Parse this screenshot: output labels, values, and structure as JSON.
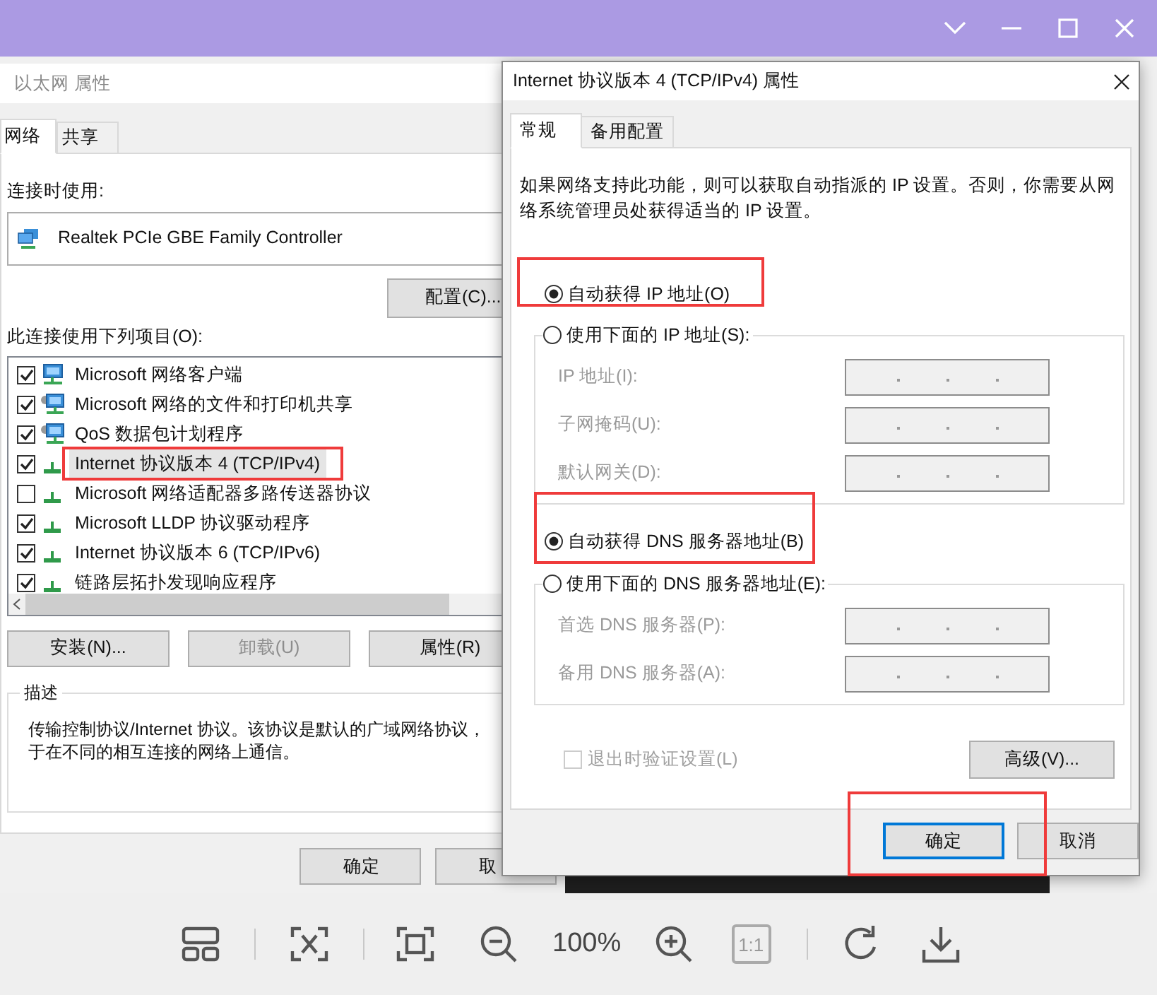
{
  "left_dialog": {
    "title": "以太网 属性",
    "tabs": [
      {
        "label": "网络",
        "selected": true
      },
      {
        "label": "共享",
        "selected": false
      }
    ],
    "connect_using_label": "连接时使用:",
    "adapter": "Realtek PCIe GBE Family Controller",
    "configure_button": "配置(C)...",
    "items_label": "此连接使用下列项目(O):",
    "items": [
      {
        "label": "Microsoft 网络客户端",
        "checked": true,
        "selected": false,
        "kind": "client"
      },
      {
        "label": "Microsoft 网络的文件和打印机共享",
        "checked": true,
        "selected": false,
        "kind": "service"
      },
      {
        "label": "QoS 数据包计划程序",
        "checked": true,
        "selected": false,
        "kind": "service"
      },
      {
        "label": "Internet 协议版本 4 (TCP/IPv4)",
        "checked": true,
        "selected": true,
        "kind": "protocol"
      },
      {
        "label": "Microsoft 网络适配器多路传送器协议",
        "checked": false,
        "selected": false,
        "kind": "protocol"
      },
      {
        "label": "Microsoft LLDP 协议驱动程序",
        "checked": true,
        "selected": false,
        "kind": "protocol"
      },
      {
        "label": "Internet 协议版本 6 (TCP/IPv6)",
        "checked": true,
        "selected": false,
        "kind": "protocol"
      },
      {
        "label": "链路层拓扑发现响应程序",
        "checked": true,
        "selected": false,
        "kind": "protocol"
      }
    ],
    "buttons": [
      {
        "label": "安装(N)...",
        "disabled": false
      },
      {
        "label": "卸载(U)",
        "disabled": true
      },
      {
        "label": "属性(R)",
        "disabled": false
      }
    ],
    "description": {
      "title": "描述",
      "lines": [
        "传输控制协议/Internet 协议。该协议是默认的广域网络协议，",
        "于在不同的相互连接的网络上通信。"
      ]
    },
    "footer_buttons": [
      "确定",
      "取"
    ]
  },
  "right_dialog": {
    "title": "Internet 协议版本 4 (TCP/IPv4) 属性",
    "tabs": [
      {
        "label": "常规",
        "selected": true
      },
      {
        "label": "备用配置",
        "selected": false
      }
    ],
    "intro_lines": [
      "如果网络支持此功能，则可以获取自动指派的 IP 设置。否则，你需要从网",
      "络系统管理员处获得适当的 IP 设置。"
    ],
    "ip_options": [
      {
        "label": "自动获得 IP 地址(O)",
        "selected": true
      },
      {
        "label": "使用下面的 IP 地址(S):",
        "selected": false
      }
    ],
    "ip_fields": [
      {
        "label": "IP 地址(I):",
        "disabled": true
      },
      {
        "label": "子网掩码(U):",
        "disabled": true
      },
      {
        "label": "默认网关(D):",
        "disabled": true
      }
    ],
    "dns_options": [
      {
        "label": "自动获得 DNS 服务器地址(B)",
        "selected": true
      },
      {
        "label": "使用下面的 DNS 服务器地址(E):",
        "selected": false
      }
    ],
    "dns_fields": [
      {
        "label": "首选 DNS 服务器(P):",
        "disabled": true
      },
      {
        "label": "备用 DNS 服务器(A):",
        "disabled": true
      }
    ],
    "validate_checkbox": {
      "label": "退出时验证设置(L)",
      "checked": false,
      "disabled": true
    },
    "advanced_button": "高级(V)...",
    "buttons": [
      {
        "label": "确定",
        "default": true
      },
      {
        "label": "取消",
        "default": false
      }
    ]
  },
  "toolbar": {
    "zoom_level": "100%",
    "actual_size": {
      "label": "1:1",
      "disabled": true
    }
  }
}
